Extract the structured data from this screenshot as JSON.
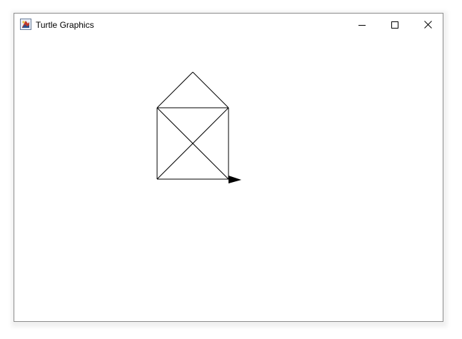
{
  "window": {
    "title": "Turtle Graphics",
    "icon": "java-app-icon",
    "controls": [
      "minimize-icon",
      "maximize-icon",
      "close-icon"
    ]
  },
  "canvas": {
    "background": "#ffffff",
    "stroke_color": "#000000",
    "turtle_color": "#000000",
    "drawing": "house"
  }
}
